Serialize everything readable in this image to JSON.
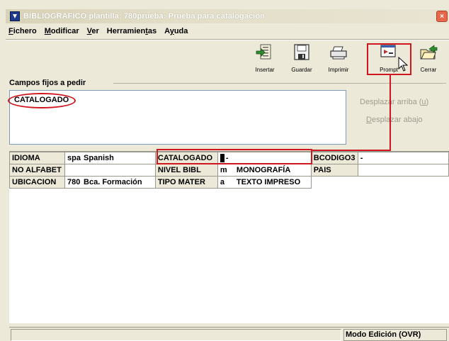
{
  "window": {
    "title": "BIBLIOGRAFICO plantilla: 780prueba: Prueba para catalogación",
    "close_glyph": "×"
  },
  "menu": [
    {
      "pre": "",
      "u": "F",
      "post": "ichero"
    },
    {
      "pre": "",
      "u": "M",
      "post": "odificar"
    },
    {
      "pre": "",
      "u": "V",
      "post": "er"
    },
    {
      "pre": "Herramien",
      "u": "t",
      "post": "as"
    },
    {
      "pre": "A",
      "u": "y",
      "post": "uda"
    }
  ],
  "toolbar": {
    "insertar": "Insertar",
    "guardar": "Guardar",
    "imprimir": "Imprimir",
    "prompt": "Prompt",
    "cerrar": "Cerrar"
  },
  "fixed_fields": {
    "group_label": "Campos fijos a pedir",
    "items": [
      "CATALOGADO"
    ],
    "move_up": {
      "pre": "Desplazar arriba (",
      "u": "u",
      "post": ")"
    },
    "move_down": {
      "pre": "",
      "u": "D",
      "post": "esplazar abajo"
    }
  },
  "grid": {
    "rows": [
      {
        "l1": "IDIOMA",
        "v1code": "spa",
        "v1text": "Spanish",
        "l2": "CATALOGADO",
        "v2code": "",
        "v2text": "-",
        "l3": "BCODIGO3",
        "v3": "-"
      },
      {
        "l1": "NO ALFABET",
        "v1code": "",
        "v1text": "",
        "l2": "NIVEL BIBL",
        "v2code": "m",
        "v2text": "MONOGRAFÍA",
        "l3": "PAIS",
        "v3": ""
      },
      {
        "l1": "UBICACION",
        "v1code": "780",
        "v1text": "Bca. Formación",
        "l2": "TIPO MATER",
        "v2code": "a",
        "v2text": "TEXTO IMPRESO",
        "l3": "",
        "v3": ""
      }
    ]
  },
  "status": {
    "left": "",
    "mode": "Modo Edición (OVR)"
  },
  "colors": {
    "highlight": "#d0161e",
    "window_bg": "#ece9d8"
  }
}
